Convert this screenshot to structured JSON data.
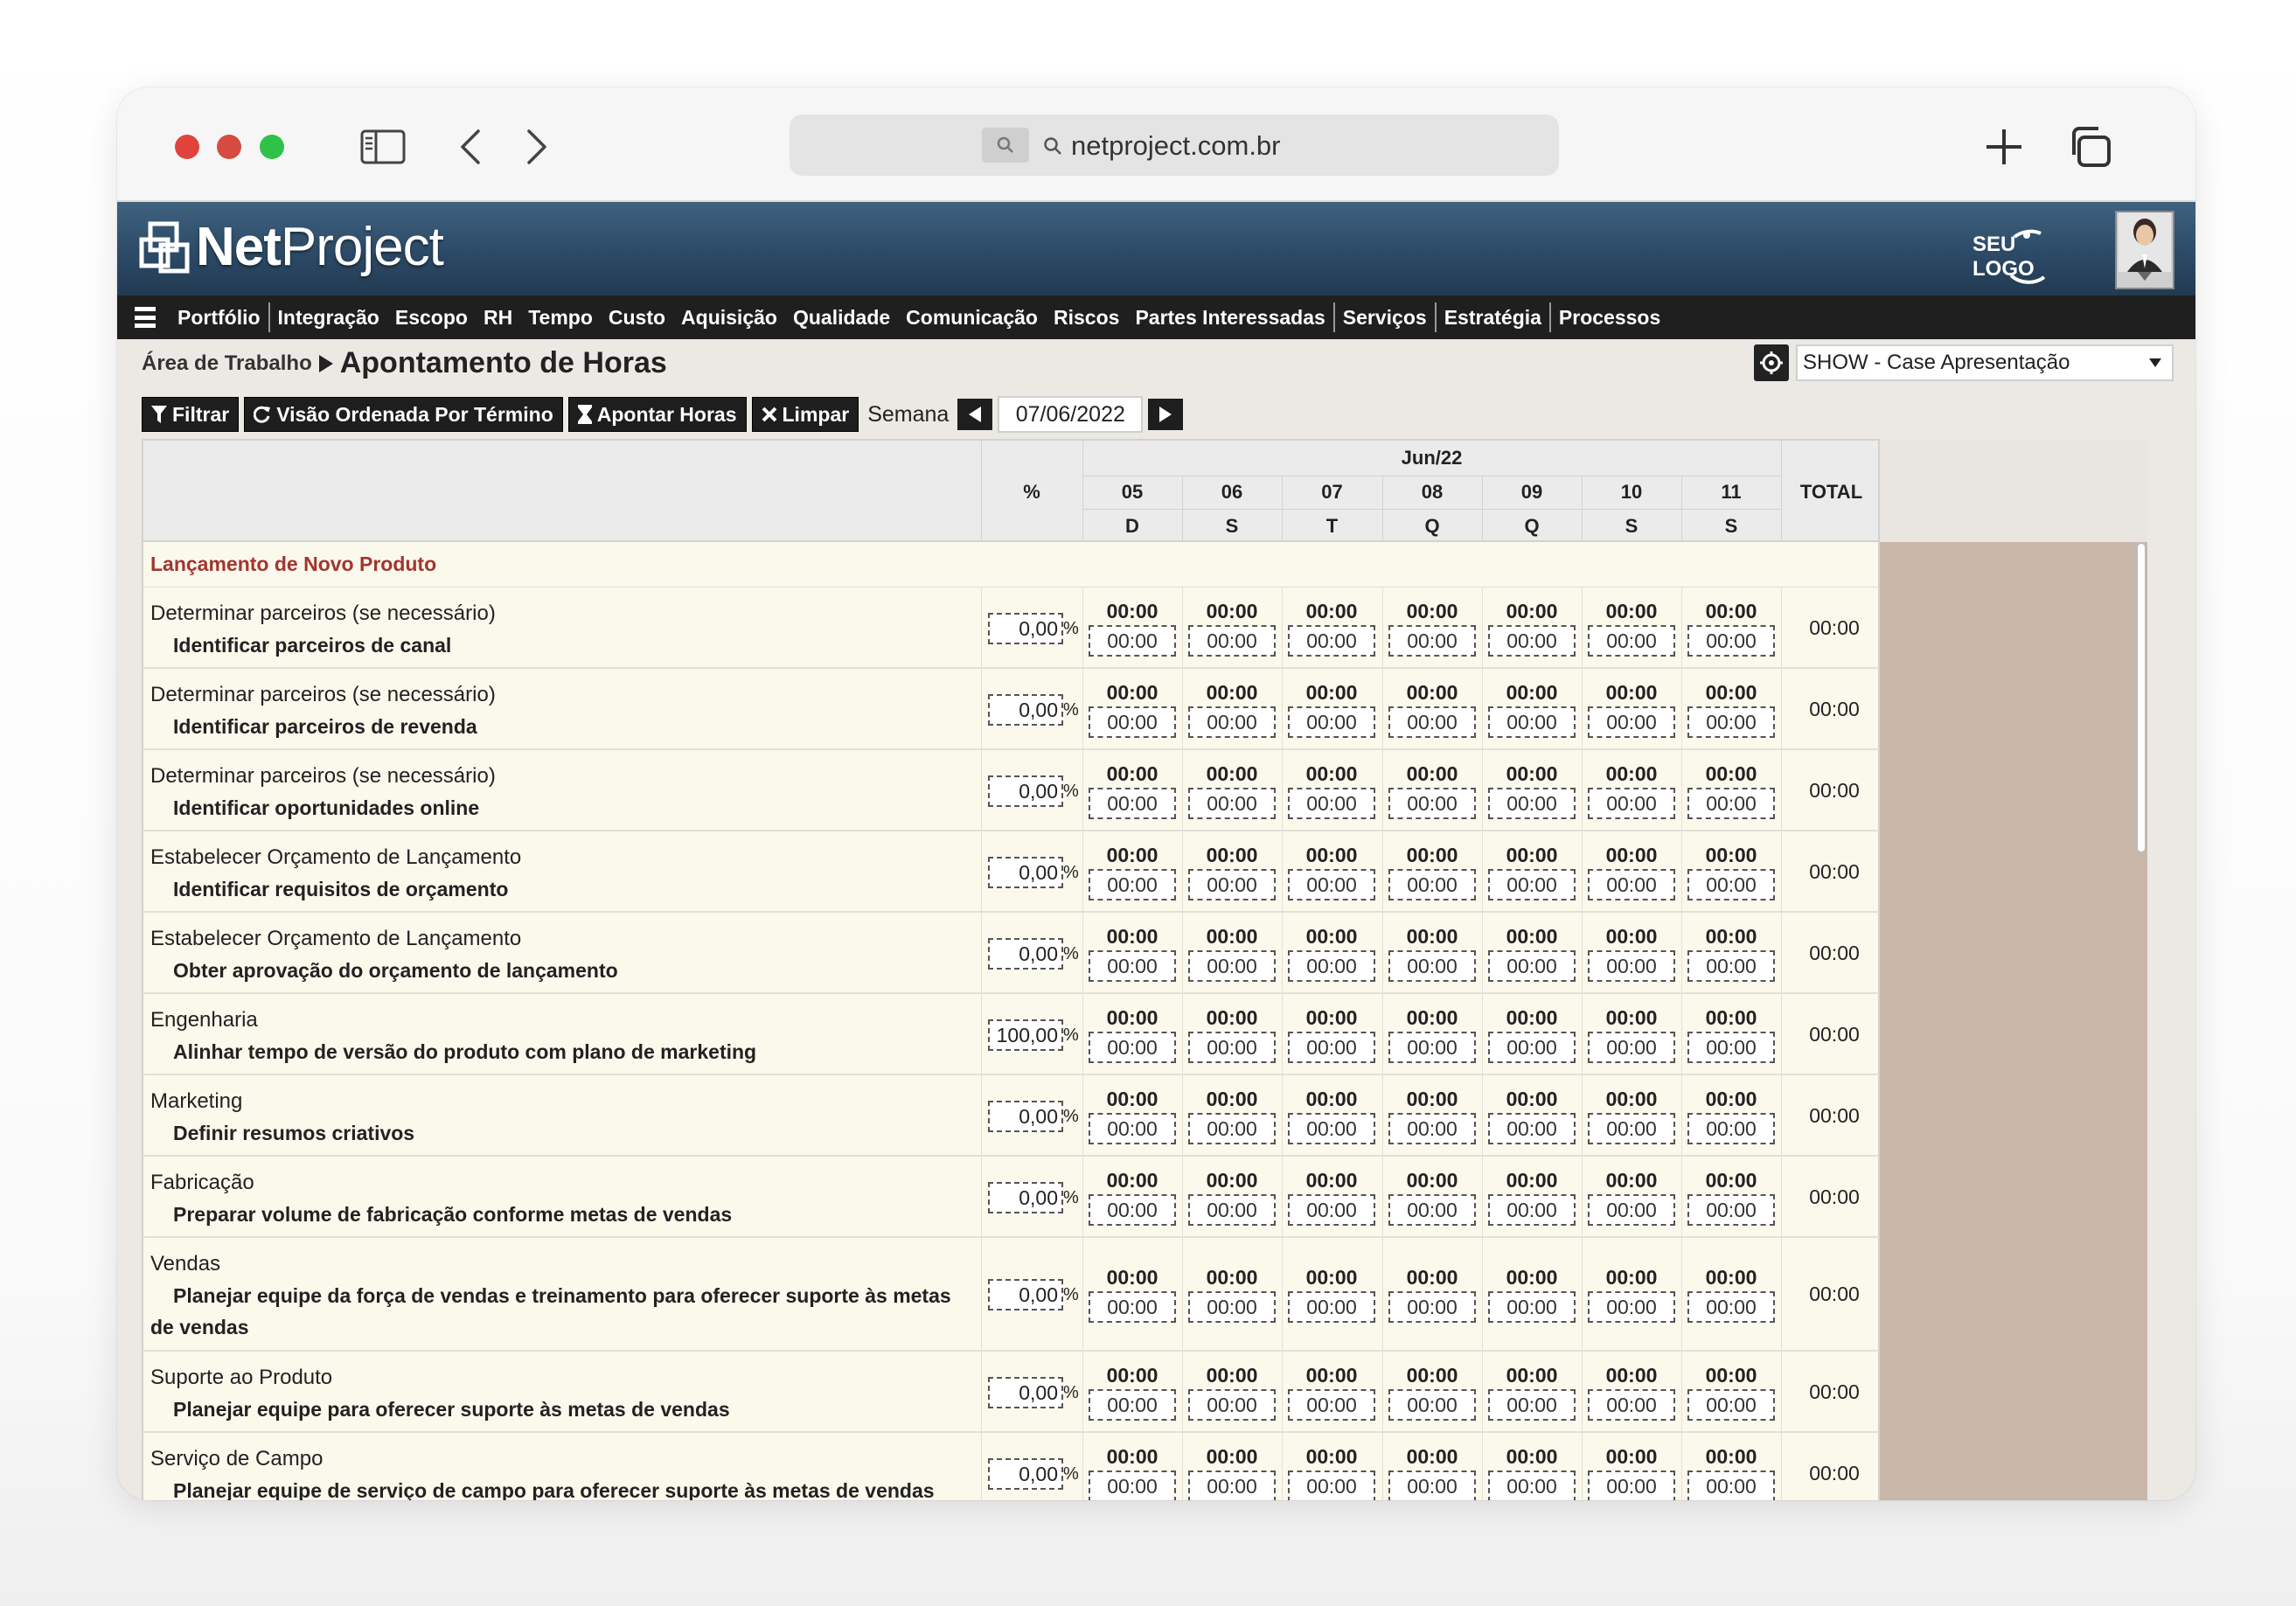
{
  "browser": {
    "url": "netproject.com.br"
  },
  "app": {
    "logo_bold": "Net",
    "logo_light": "Project",
    "brand_placeholder": "SEU LOGO"
  },
  "menu": [
    "Portfólio",
    "Integração",
    "Escopo",
    "RH",
    "Tempo",
    "Custo",
    "Aquisição",
    "Qualidade",
    "Comunicação",
    "Riscos",
    "Partes Interessadas",
    "Serviços",
    "Estratégia",
    "Processos"
  ],
  "breadcrumb": {
    "parent": "Área de Trabalho",
    "current": "Apontamento de Horas"
  },
  "project_selector": {
    "value": "SHOW - Case Apresentação"
  },
  "toolbar": {
    "filter": "Filtrar",
    "ordered_view": "Visão Ordenada Por Término",
    "log_hours": "Apontar Horas",
    "clear": "Limpar",
    "week_label": "Semana",
    "week_date": "07/06/2022"
  },
  "table": {
    "month": "Jun/22",
    "percent_header": "%",
    "total_header": "TOTAL",
    "days": [
      {
        "num": "05",
        "letter": "D"
      },
      {
        "num": "06",
        "letter": "S"
      },
      {
        "num": "07",
        "letter": "T"
      },
      {
        "num": "08",
        "letter": "Q"
      },
      {
        "num": "09",
        "letter": "Q"
      },
      {
        "num": "10",
        "letter": "S"
      },
      {
        "num": "11",
        "letter": "S"
      }
    ],
    "section_title": "Lançamento de Novo Produto",
    "rows": [
      {
        "phase": "Determinar parceiros (se necessário)",
        "task": "Identificar parceiros de canal",
        "pct": "0,00",
        "total": "00:00"
      },
      {
        "phase": "Determinar parceiros (se necessário)",
        "task": "Identificar parceiros de revenda",
        "pct": "0,00",
        "total": "00:00"
      },
      {
        "phase": "Determinar parceiros (se necessário)",
        "task": "Identificar oportunidades online",
        "pct": "0,00",
        "total": "00:00"
      },
      {
        "phase": "Estabelecer Orçamento de Lançamento",
        "task": "Identificar requisitos de orçamento",
        "pct": "0,00",
        "total": "00:00"
      },
      {
        "phase": "Estabelecer Orçamento de Lançamento",
        "task": "Obter aprovação do orçamento de lançamento",
        "pct": "0,00",
        "total": "00:00"
      },
      {
        "phase": "Engenharia",
        "task": "Alinhar tempo de versão do produto com plano de marketing",
        "pct": "100,00",
        "total": "00:00"
      },
      {
        "phase": "Marketing",
        "task": "Definir resumos criativos",
        "pct": "0,00",
        "total": "00:00"
      },
      {
        "phase": "Fabricação",
        "task": "Preparar volume de fabricação conforme metas de vendas",
        "pct": "0,00",
        "total": "00:00"
      },
      {
        "phase": "Vendas",
        "task": "Planejar equipe da força de vendas e treinamento para oferecer suporte às metas de vendas",
        "pct": "0,00",
        "total": "00:00"
      },
      {
        "phase": "Suporte ao Produto",
        "task": "Planejar equipe para oferecer suporte às metas de vendas",
        "pct": "0,00",
        "total": "00:00"
      },
      {
        "phase": "Serviço de Campo",
        "task": "Planejar equipe de serviço de campo para oferecer suporte às metas de vendas",
        "pct": "0,00",
        "total": "00:00"
      }
    ],
    "time_value": "00:00",
    "percent_sign": "%"
  },
  "icons": {
    "sidebar_toggle": "sidebar-icon",
    "back": "chevron-left-icon",
    "forward": "chevron-right-icon",
    "new_tab": "plus-icon",
    "tabs": "tabs-icon",
    "search": "search-icon",
    "menu": "hamburger-icon",
    "filter": "filter-icon",
    "refresh": "refresh-icon",
    "hourglass": "hourglass-icon",
    "clear": "x-icon",
    "prev_week": "triangle-left-icon",
    "next_week": "triangle-right-icon",
    "project_target": "target-icon",
    "dropdown": "caret-down-icon"
  },
  "colors": {
    "header_blue": "#2c4a66",
    "menu_black": "#1f1f1f",
    "section_red": "#a2352f",
    "row_cream": "#fbf8ec",
    "gutter_tan": "#c8b6a9"
  }
}
